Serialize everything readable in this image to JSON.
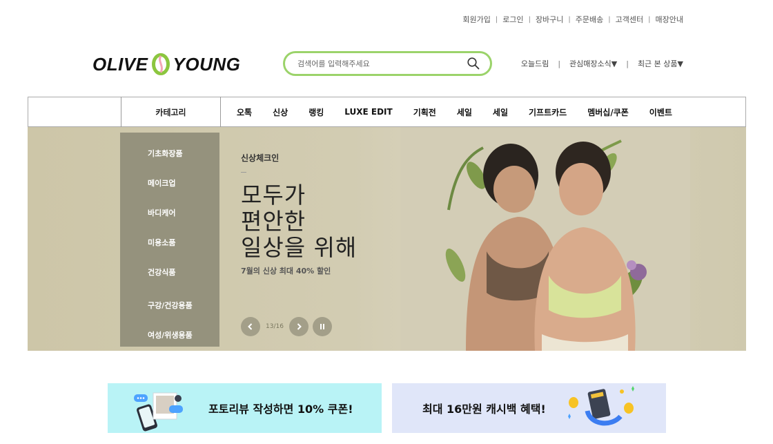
{
  "util_nav": [
    "회원가입",
    "로그인",
    "장바구니",
    "주문배송",
    "고객센터",
    "매장안내"
  ],
  "logo": {
    "left": "OLIVE",
    "right": "YOUNG"
  },
  "search": {
    "placeholder": "검색어를 입력해주세요",
    "icon": "search-icon"
  },
  "user_nav": [
    "오늘드림",
    "관심매장소식▼",
    "최근 본 상품▼"
  ],
  "gnb": {
    "category_label": "카테고리",
    "menu": [
      "오톡",
      "신상",
      "랭킹",
      "LUXE EDIT",
      "기획전",
      "세일",
      "세일",
      "기프트카드",
      "멤버십/쿠폰",
      "이벤트"
    ]
  },
  "category_panel": [
    "기초화장품",
    "메이크업",
    "바디케어",
    "미용소품",
    "건강식품",
    "구강/건강용품",
    "여성/위생용품"
  ],
  "banner": {
    "kicker": "신상체크인",
    "headline": "모두가\n편안한\n일상을 위해",
    "sub": "7월의 신상 최대 40% 할인",
    "pager": "13/16"
  },
  "promos": {
    "left": "포토리뷰 작성하면 10% 쿠폰!",
    "right": "최대 16만원 캐시백 혜택!"
  },
  "colors": {
    "search_border": "#9bd36a",
    "logo_mark": "#8cc63f",
    "category_panel": "#95927d",
    "promo_left_bg": "#b9f3f6",
    "promo_right_bg": "#e0e6f9"
  }
}
